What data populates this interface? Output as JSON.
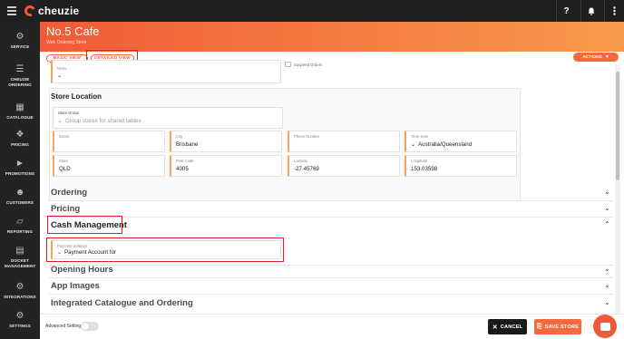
{
  "app": {
    "brand": "cheuzie",
    "accent_color": "#f15a36"
  },
  "topbar": {
    "help_icon": "question-icon",
    "help_label": "?",
    "notification_icon": "bell-icon",
    "menu_icon": "vertical-dots-icon"
  },
  "sidebar": {
    "items": [
      {
        "label": "SERVICE",
        "icon": "service-icon"
      },
      {
        "label": "CHEUZIE ORDERING",
        "icon": "ordering-icon"
      },
      {
        "label": "CATALOGUE",
        "icon": "catalogue-icon"
      },
      {
        "label": "PRICING",
        "icon": "tag-icon"
      },
      {
        "label": "PROMOTIONS",
        "icon": "megaphone-icon"
      },
      {
        "label": "CUSTOMERS",
        "icon": "customers-icon"
      },
      {
        "label": "REPORTING",
        "icon": "chart-icon"
      },
      {
        "label": "DOCKET MANAGEMENT",
        "icon": "docket-icon"
      },
      {
        "label": "INTEGRATIONS",
        "icon": "plug-icon"
      },
      {
        "label": "SETTINGS",
        "icon": "gear-icon"
      }
    ]
  },
  "header": {
    "title": "No.5 Cafe",
    "subtitle": "Web Ordering Store"
  },
  "views": {
    "basic": "BASIC VIEW",
    "detailed": "DETAILED VIEW",
    "actions": "ACTIONS"
  },
  "menu_field": {
    "label": "Menu",
    "value": ""
  },
  "suspend_orders": {
    "label": "Suspend Orders"
  },
  "store_location": {
    "title": "Store Location",
    "store_group": {
      "label": "Store Group",
      "placeholder": "Group stores for shared tables"
    },
    "fields": {
      "street": {
        "label": "Street",
        "value": ""
      },
      "city": {
        "label": "City",
        "value": "Brisbane"
      },
      "phone": {
        "label": "Phone Number",
        "value": ""
      },
      "timezone": {
        "label": "Time zone",
        "value": "Australia/Queensland"
      },
      "state": {
        "label": "State",
        "value": "QLD"
      },
      "postcode": {
        "label": "Post Code",
        "value": "4005"
      },
      "latitude": {
        "label": "Latitude",
        "value": "-27.45769"
      },
      "longitude": {
        "label": "Longitude",
        "value": "153.03598"
      }
    }
  },
  "sections": {
    "ordering": "Ordering",
    "pricing": "Pricing",
    "cash_management": "Cash Management",
    "opening_hours": "Opening Hours",
    "app_images": "App Images",
    "integrated": "Integrated Catalogue and Ordering"
  },
  "payment_settings": {
    "label": "Payment Settings",
    "value": "Payment Account for"
  },
  "footer": {
    "advanced_settings": "Advanced Settings",
    "cancel": "CANCEL",
    "save": "SAVE STORE"
  }
}
